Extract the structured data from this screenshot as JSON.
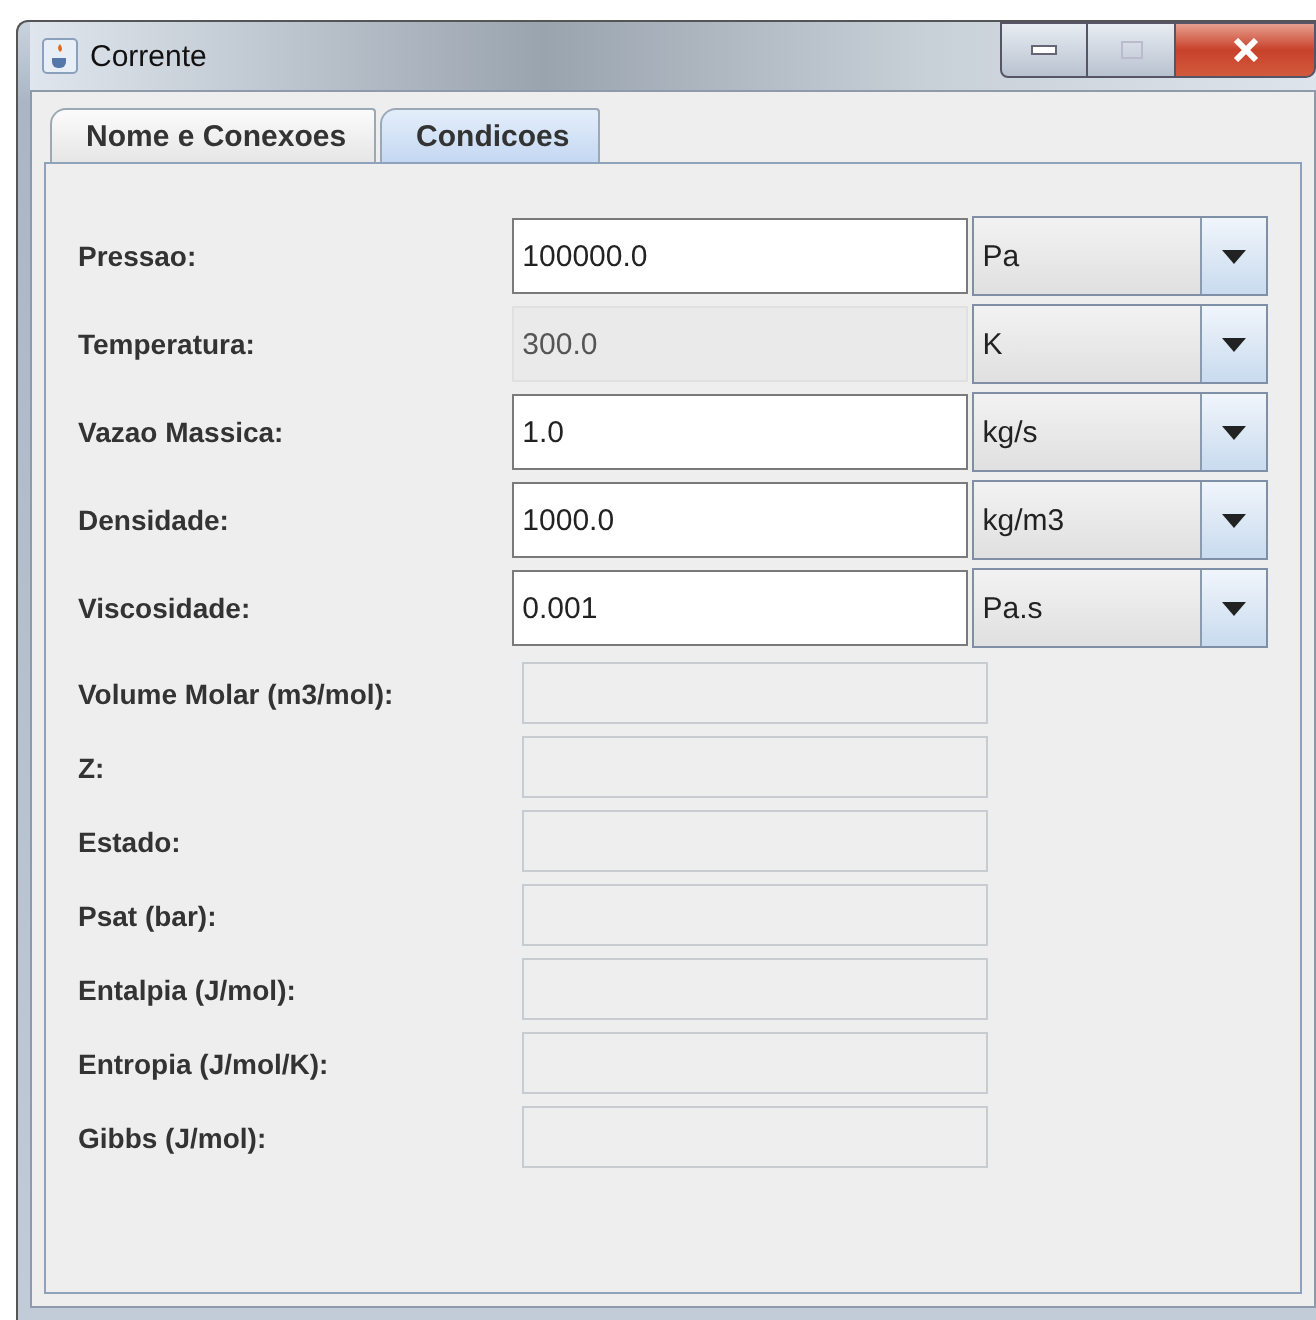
{
  "window": {
    "title": "Corrente"
  },
  "tabs": [
    {
      "label": "Nome e Conexoes",
      "selected": false
    },
    {
      "label": "Condicoes",
      "selected": true
    }
  ],
  "rows": [
    {
      "label": "Pressao:",
      "value": "100000.0",
      "editable": true,
      "unit": "Pa"
    },
    {
      "label": "Temperatura:",
      "value": "300.0",
      "editable": false,
      "unit": "K"
    },
    {
      "label": "Vazao Massica:",
      "value": "1.0",
      "editable": true,
      "unit": "kg/s"
    },
    {
      "label": "Densidade:",
      "value": "1000.0",
      "editable": true,
      "unit": "kg/m3"
    },
    {
      "label": "Viscosidade:",
      "value": "0.001",
      "editable": true,
      "unit": "Pa.s"
    },
    {
      "label": "Volume Molar (m3/mol):",
      "editable": false
    },
    {
      "label": "Z:",
      "editable": false
    },
    {
      "label": "Estado:",
      "editable": false
    },
    {
      "label": "Psat (bar):",
      "editable": false
    },
    {
      "label": "Entalpia (J/mol):",
      "editable": false
    },
    {
      "label": "Entropia (J/mol/K):",
      "editable": false
    },
    {
      "label": "Gibbs (J/mol):",
      "editable": false
    }
  ]
}
